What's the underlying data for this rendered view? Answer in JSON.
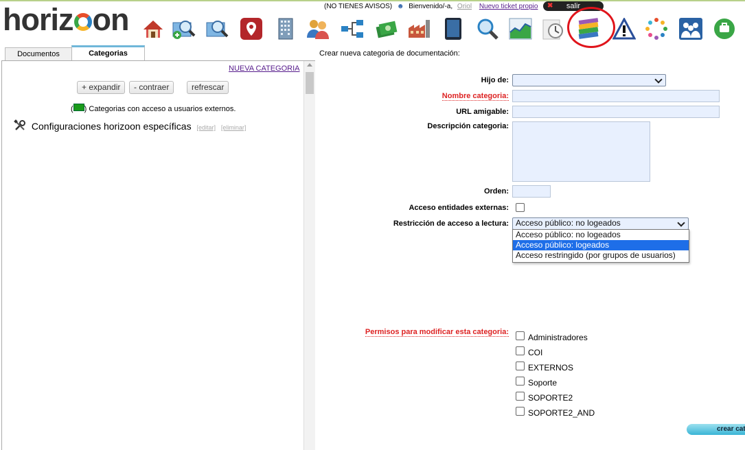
{
  "header": {
    "logo_text_1": "horiz",
    "logo_text_2": "on",
    "notices": "(NO TIENES AVISOS)",
    "welcome": "Bienvenido/-a,",
    "user": "Oriol",
    "new_ticket": "Nuevo ticket propio",
    "logout": "salir",
    "toolbar_icons": [
      "home-icon",
      "search-add-icon",
      "search-docs-icon",
      "location-pin-icon",
      "building-icon",
      "users-icon",
      "network-icon",
      "money-icon",
      "factory-icon",
      "tablet-icon",
      "magnifier-icon",
      "chart-icon",
      "clock-icon",
      "books-icon",
      "warning-icon",
      "loading-dots-icon",
      "team-icon",
      "badge-icon"
    ]
  },
  "tabs": {
    "documents": "Documentos",
    "categories": "Categorias"
  },
  "left": {
    "new_category": "NUEVA CATEGORIA",
    "expand": "+ expandir",
    "collapse": "- contraer",
    "refresh": "refrescar",
    "legend_open": "(",
    "legend_close": ")",
    "legend_text": "Categorias con acceso a usuarios externos.",
    "tree_item": "Configuraciones horizoon específicas",
    "edit": "[editar]",
    "delete": "[eliminar]"
  },
  "form": {
    "title": "Crear nueva categoria de documentación:",
    "parent_label": "Hijo de:",
    "parent_value": "",
    "name_label": "Nombre categoria:",
    "name_value": "",
    "url_label": "URL amigable:",
    "url_value": "",
    "desc_label": "Descripción categoria:",
    "desc_value": "",
    "order_label": "Orden:",
    "order_value": "",
    "external_label": "Acceso entidades externas:",
    "restriction_label": "Restricción de acceso a lectura:",
    "restriction_value": "Acceso público: no logeados",
    "restriction_options": [
      "Acceso público: no logeados",
      "Acceso público: logeados",
      "Acceso restringido (por grupos de usuarios)"
    ],
    "permissions_label": "Permisos para modificar esta categoria:",
    "groups": [
      "Administradores",
      "COI",
      "EXTERNOS",
      "Soporte",
      "SOPORTE2",
      "SOPORTE2_AND"
    ],
    "create_button": "crear cat"
  },
  "colors": {
    "accent": "#6fb7d9",
    "required": "#dd2222",
    "highlight_circle": "#e0141b",
    "selected_option": "#1e6ee8"
  }
}
